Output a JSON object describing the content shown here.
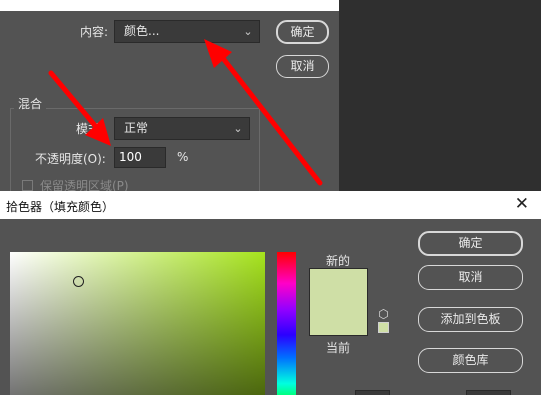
{
  "fill_dialog": {
    "content_label": "内容:",
    "content_value": "颜色...",
    "ok_label": "确定",
    "cancel_label": "取消",
    "blending_group_label": "混合",
    "mode_label_partial": "模式",
    "mode_value": "正常",
    "opacity_label": "不透明度(O):",
    "opacity_value": "100",
    "opacity_unit": "%",
    "preserve_transparency_label": "保留透明区域(P)"
  },
  "color_picker": {
    "title": "拾色器（填充颜色）",
    "new_label": "新的",
    "current_label": "当前",
    "ok_label": "确定",
    "cancel_label": "取消",
    "add_to_swatches_label": "添加到色板",
    "color_libraries_label": "颜色库",
    "new_color": "#cfdfa6",
    "current_color": "#cfdfa6",
    "hue_color": "#a6e31d"
  },
  "annotation_color": "#ff0000"
}
